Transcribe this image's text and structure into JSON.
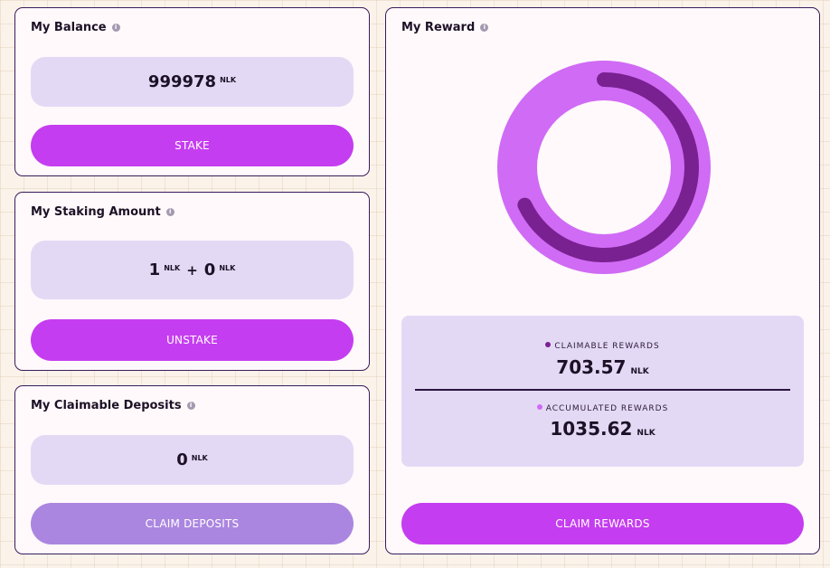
{
  "balance": {
    "title": "My Balance",
    "info_icon": "info-icon",
    "amount": "999978",
    "unit": "NLK",
    "button": "STAKE"
  },
  "staking": {
    "title": "My Staking Amount",
    "info_icon": "info-icon",
    "amount_a": "1",
    "unit_a": "NLK",
    "plus": "+",
    "amount_b": "0",
    "unit_b": "NLK",
    "button": "UNSTAKE"
  },
  "deposits": {
    "title": "My Claimable Deposits",
    "info_icon": "info-icon",
    "amount": "0",
    "unit": "NLK",
    "button": "CLAIM DEPOSITS"
  },
  "reward": {
    "title": "My Reward",
    "info_icon": "info-icon",
    "claimable_label": "CLAIMABLE REWARDS",
    "claimable_value": "703.57",
    "claimable_unit": "NLK",
    "accumulated_label": "ACCUMULATED REWARDS",
    "accumulated_value": "1035.62",
    "accumulated_unit": "NLK",
    "button": "CLAIM REWARDS",
    "claimable_fraction": 0.6794,
    "colors": {
      "claimable": "#7a2191",
      "accumulated": "#d06bf5"
    }
  },
  "colors": {
    "accent": "#c53df0",
    "disabled_button": "#ab86e0",
    "value_box": "#e4d9f5",
    "card_border": "#3b1a5c"
  }
}
